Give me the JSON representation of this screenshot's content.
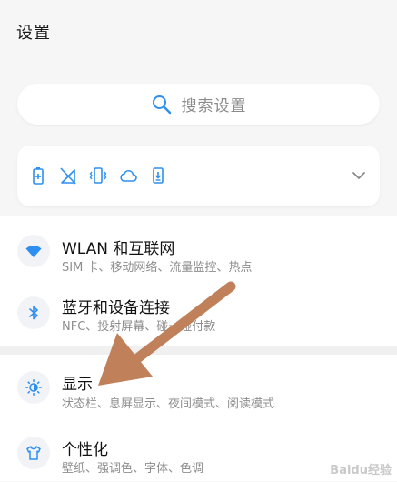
{
  "header": {
    "title": "设置"
  },
  "search": {
    "placeholder": "搜索设置",
    "icon": "search-icon"
  },
  "quick_toggles": {
    "icons": [
      "battery-icon",
      "mobile-data-off-icon",
      "vibrate-icon",
      "cloud-icon",
      "download-icon"
    ],
    "expand_icon": "chevron-down-icon"
  },
  "settings": [
    {
      "title": "WLAN 和互联网",
      "subtitle": "SIM 卡、移动网络、流量监控、热点",
      "icon": "wifi-icon"
    },
    {
      "title": "蓝牙和设备连接",
      "subtitle": "NFC、投射屏幕、碰一碰付款",
      "icon": "bluetooth-icon"
    },
    {
      "title": "显示",
      "subtitle": "状态栏、息屏显示、夜间模式、阅读模式",
      "icon": "brightness-icon"
    },
    {
      "title": "个性化",
      "subtitle": "壁纸、强调色、字体、色调",
      "icon": "shirt-icon"
    }
  ],
  "colors": {
    "accent": "#2f8ff0",
    "arrow": "#c0805a"
  },
  "watermark": "Baidu经验"
}
